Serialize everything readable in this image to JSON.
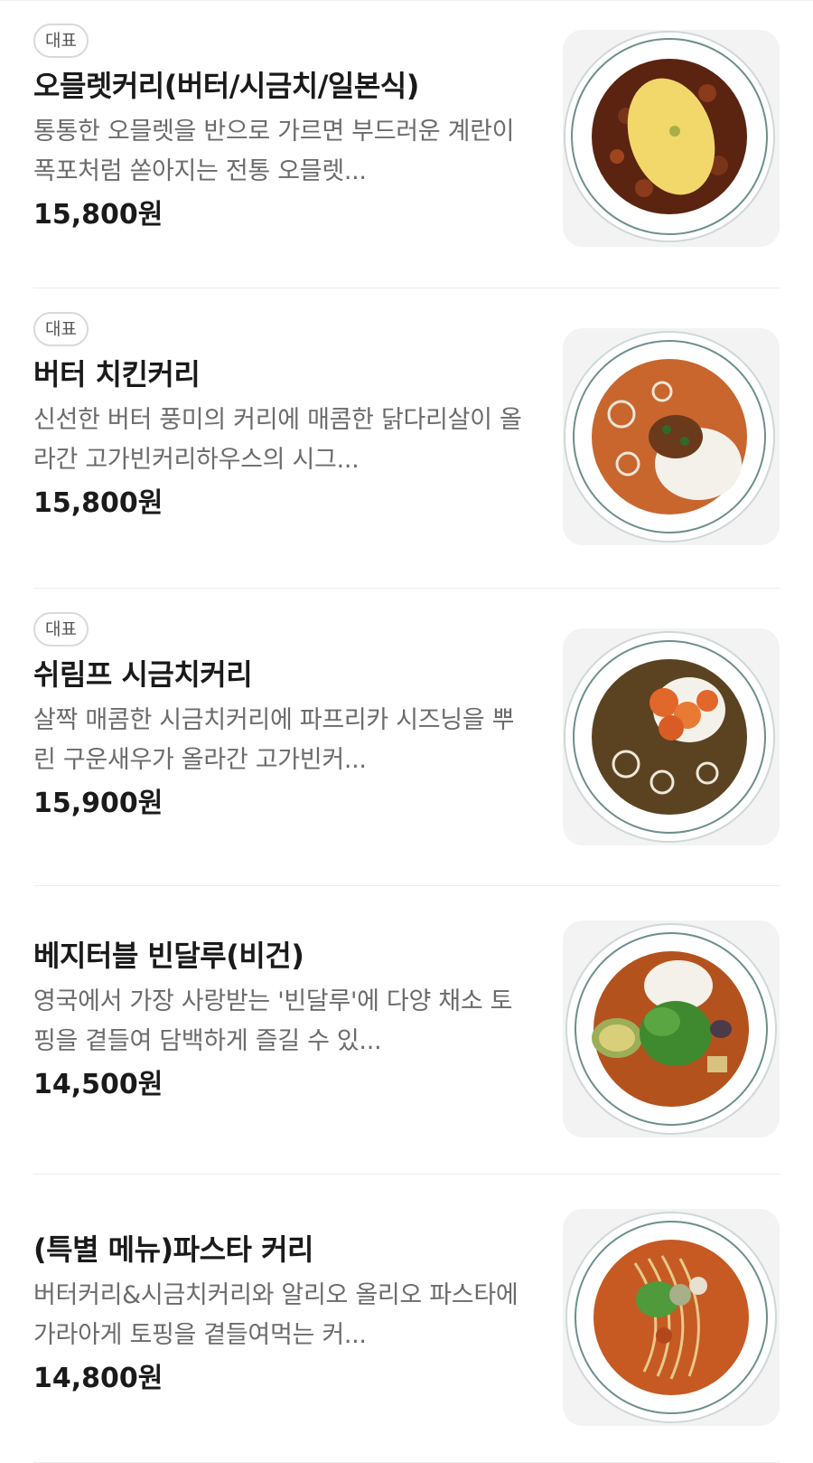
{
  "menu": {
    "items": [
      {
        "badge": "대표",
        "name": "오믈렛커리(버터/시금치/일본식)",
        "description": "통통한 오믈렛을 반으로 가르면 부드러운 계란이 폭포처럼 쏟아지는 전통 오믈렛...",
        "price": "15,800원",
        "image": "omelette-curry-photo",
        "curry_color": "#5a2410",
        "topping_color": "#f2d86a"
      },
      {
        "badge": "대표",
        "name": "버터 치킨커리",
        "description": "신선한 버터 풍미의 커리에 매콤한 닭다리살이 올라간 고가빈커리하우스의 시그...",
        "price": "15,800원",
        "image": "butter-chicken-curry-photo",
        "curry_color": "#c8662e",
        "topping_color": "#6b3a1c"
      },
      {
        "badge": "대표",
        "name": "쉬림프 시금치커리",
        "description": "살짝 매콤한 시금치커리에 파프리카 시즈닝을 뿌린 구운새우가 올라간 고가빈커...",
        "price": "15,900원",
        "image": "shrimp-spinach-curry-photo",
        "curry_color": "#5b4322",
        "topping_color": "#e2672a"
      },
      {
        "badge": "",
        "name": "베지터블 빈달루(비건)",
        "description": "영국에서 가장 사랑받는 '빈달루'에 다양 채소 토핑을 곁들여 담백하게 즐길 수 있...",
        "price": "14,500원",
        "image": "vegetable-vindaloo-photo",
        "curry_color": "#b4521e",
        "topping_color": "#3f8a2e"
      },
      {
        "badge": "",
        "name": "(특별 메뉴)파스타 커리",
        "description": "버터커리&시금치커리와 알리오 올리오 파스타에 가라아게 토핑을 곁들여먹는 커...",
        "price": "14,800원",
        "image": "pasta-curry-photo",
        "curry_color": "#c65a22",
        "topping_color": "#e8c98a"
      }
    ]
  }
}
